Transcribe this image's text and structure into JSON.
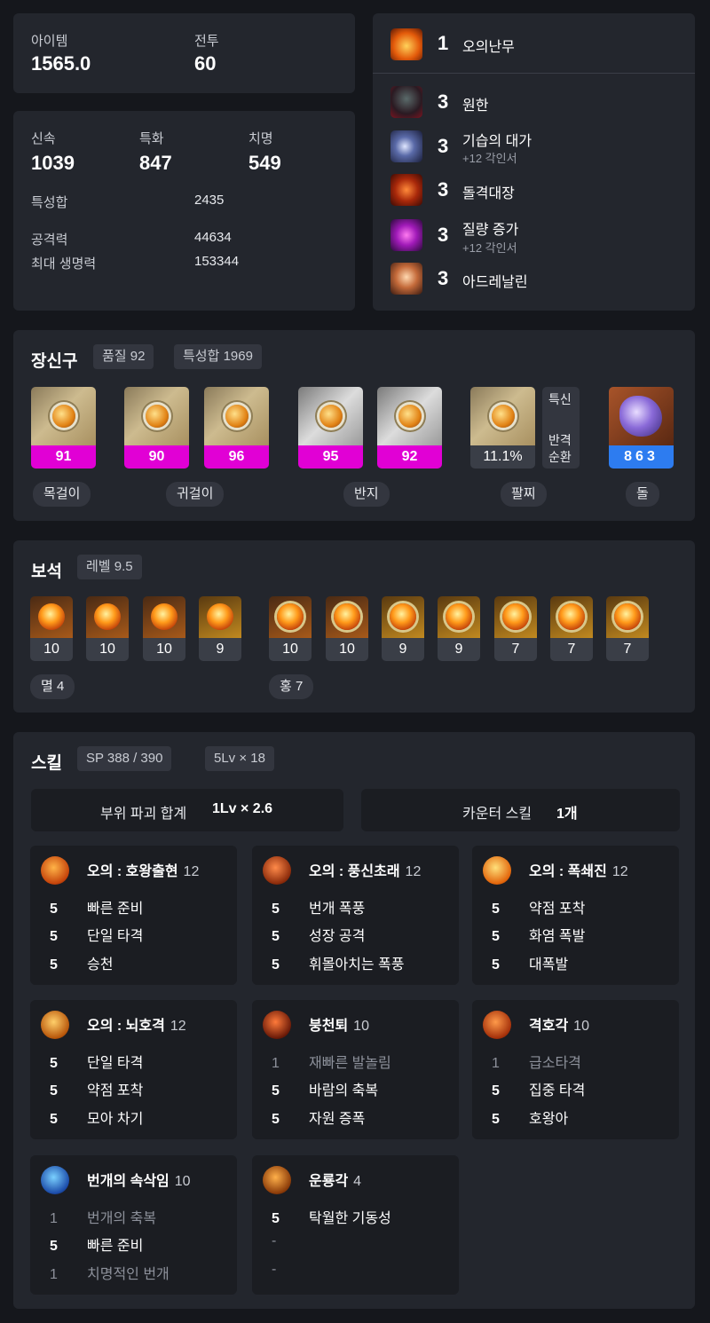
{
  "overview": {
    "item_label": "아이템",
    "item_value": "1565.0",
    "combat_label": "전투",
    "combat_value": "60"
  },
  "stats": {
    "swift_label": "신속",
    "swift_value": "1039",
    "spec_label": "특화",
    "spec_value": "847",
    "crit_label": "치명",
    "crit_value": "549",
    "total_label": "특성합",
    "total_value": "2435",
    "atk_label": "공격력",
    "atk_value": "44634",
    "hp_label": "최대 생명력",
    "hp_value": "153344"
  },
  "engravings": [
    {
      "level": "1",
      "name": "오의난무",
      "sub": "",
      "icon": "orange-flame-icon"
    },
    {
      "level": "3",
      "name": "원한",
      "sub": "",
      "icon": "dark-beast-icon"
    },
    {
      "level": "3",
      "name": "기습의 대가",
      "sub": "+12 각인서",
      "icon": "moon-slash-icon"
    },
    {
      "level": "3",
      "name": "돌격대장",
      "sub": "",
      "icon": "charge-icon"
    },
    {
      "level": "3",
      "name": "질량 증가",
      "sub": "+12 각인서",
      "icon": "purple-fist-icon"
    },
    {
      "level": "3",
      "name": "아드레날린",
      "sub": "",
      "icon": "adrenaline-icon"
    }
  ],
  "accessories": {
    "title": "장신구",
    "quality_pill": "품질 92",
    "stat_pill": "특성합 1969",
    "items": [
      {
        "value": "91"
      },
      {
        "value": "90"
      },
      {
        "value": "96"
      },
      {
        "value": "95"
      },
      {
        "value": "92"
      }
    ],
    "bracelet_value": "11.1%",
    "bracelet_opts": {
      "a": "특신",
      "b": "반격",
      "c": "순환"
    },
    "stone_value": "863",
    "labels": {
      "necklace": "목걸이",
      "earring": "귀걸이",
      "ring": "반지",
      "bracelet": "팔찌",
      "stone": "돌"
    }
  },
  "gems": {
    "title": "보석",
    "level_pill": "레벨 9.5",
    "left": [
      "10",
      "10",
      "10",
      "9"
    ],
    "right": [
      "10",
      "10",
      "9",
      "9",
      "7",
      "7",
      "7"
    ],
    "left_label": "멸 4",
    "right_label": "홍 7"
  },
  "skills": {
    "title": "스킬",
    "sp_pill": "SP 388 / 390",
    "lv_pill": "5Lv × 18",
    "break_label": "부위 파괴 합계",
    "break_value": "1Lv × 2.6",
    "counter_label": "카운터 스킬",
    "counter_value": "1개",
    "cards": [
      {
        "name": "오의 : 호왕출현",
        "level": "12",
        "icon": "fire-tiger-icon",
        "colors": [
          "#ffb347",
          "#c4420a"
        ],
        "tripods": [
          {
            "lv": "5",
            "name": "빠른 준비",
            "dim": false
          },
          {
            "lv": "5",
            "name": "단일 타격",
            "dim": false
          },
          {
            "lv": "5",
            "name": "승천",
            "dim": false
          }
        ]
      },
      {
        "name": "오의 : 풍신초래",
        "level": "12",
        "icon": "wind-god-icon",
        "colors": [
          "#ff8a4a",
          "#8a2a0a"
        ],
        "tripods": [
          {
            "lv": "5",
            "name": "번개 폭풍",
            "dim": false
          },
          {
            "lv": "5",
            "name": "성장 공격",
            "dim": false
          },
          {
            "lv": "5",
            "name": "휘몰아치는 폭풍",
            "dim": false
          }
        ]
      },
      {
        "name": "오의 : 폭쇄진",
        "level": "12",
        "icon": "explosion-icon",
        "colors": [
          "#ffe07a",
          "#e2640a"
        ],
        "tripods": [
          {
            "lv": "5",
            "name": "약점 포착",
            "dim": false
          },
          {
            "lv": "5",
            "name": "화염 폭발",
            "dim": false
          },
          {
            "lv": "5",
            "name": "대폭발",
            "dim": false
          }
        ]
      },
      {
        "name": "오의 : 뇌호격",
        "level": "12",
        "icon": "thunder-tiger-icon",
        "colors": [
          "#ffcf6a",
          "#b8560a"
        ],
        "tripods": [
          {
            "lv": "5",
            "name": "단일 타격",
            "dim": false
          },
          {
            "lv": "5",
            "name": "약점 포착",
            "dim": false
          },
          {
            "lv": "5",
            "name": "모아 차기",
            "dim": false
          }
        ]
      },
      {
        "name": "붕천퇴",
        "level": "10",
        "icon": "sky-kick-icon",
        "colors": [
          "#ff7a3a",
          "#6a1a08"
        ],
        "tripods": [
          {
            "lv": "1",
            "name": "재빠른 발놀림",
            "dim": true
          },
          {
            "lv": "5",
            "name": "바람의 축복",
            "dim": false
          },
          {
            "lv": "5",
            "name": "자원 증폭",
            "dim": false
          }
        ]
      },
      {
        "name": "격호각",
        "level": "10",
        "icon": "tiger-kick-icon",
        "colors": [
          "#ff9a4a",
          "#a4300a"
        ],
        "tripods": [
          {
            "lv": "1",
            "name": "급소타격",
            "dim": true
          },
          {
            "lv": "5",
            "name": "집중 타격",
            "dim": false
          },
          {
            "lv": "5",
            "name": "호왕아",
            "dim": false
          }
        ]
      },
      {
        "name": "번개의 속삭임",
        "level": "10",
        "icon": "lightning-whisper-icon",
        "colors": [
          "#7ad0ff",
          "#1a4aa8"
        ],
        "tripods": [
          {
            "lv": "1",
            "name": "번개의 축복",
            "dim": true
          },
          {
            "lv": "5",
            "name": "빠른 준비",
            "dim": false
          },
          {
            "lv": "1",
            "name": "치명적인 번개",
            "dim": true
          }
        ]
      },
      {
        "name": "운룡각",
        "level": "4",
        "icon": "cloud-dragon-icon",
        "colors": [
          "#ffb04a",
          "#8a3a08"
        ],
        "tripods": [
          {
            "lv": "5",
            "name": "탁월한 기동성",
            "dim": false
          },
          {
            "lv": "-",
            "name": "",
            "dim": true
          },
          {
            "lv": "-",
            "name": "",
            "dim": true
          }
        ]
      }
    ]
  },
  "colors": {
    "accent_magenta": "#e100d5",
    "accent_blue": "#2d7cf0",
    "panel": "#23262d",
    "bg": "#15171c"
  }
}
